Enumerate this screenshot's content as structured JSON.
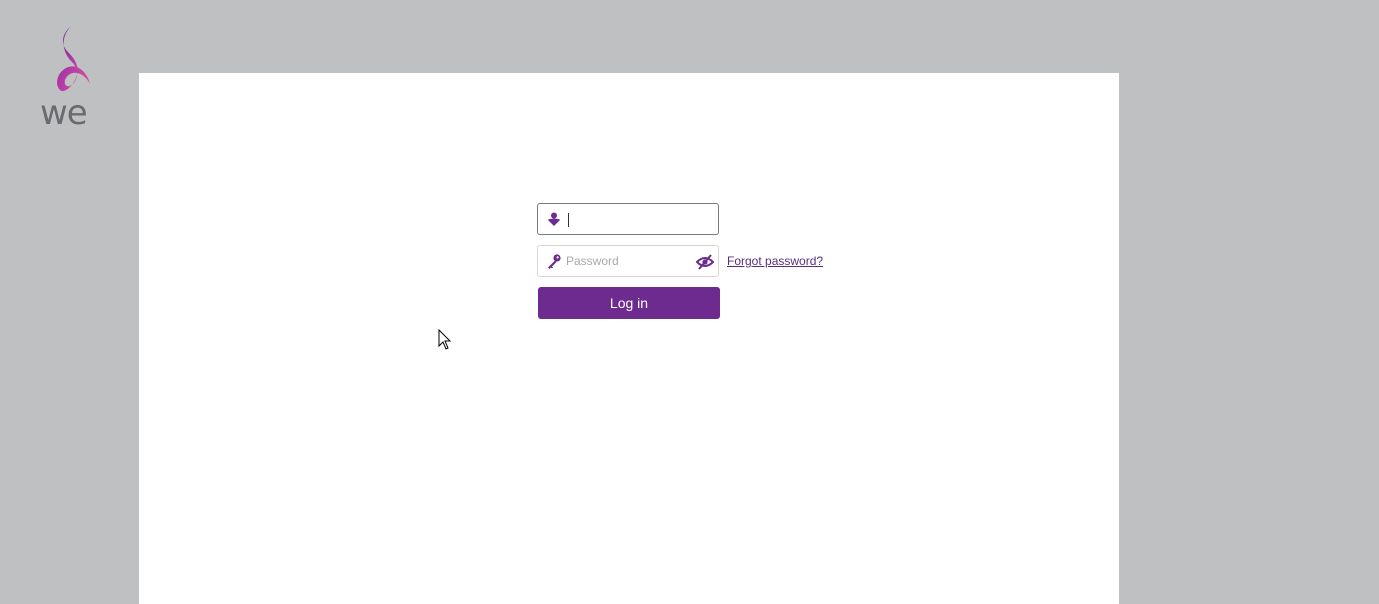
{
  "brand": {
    "logo_text": "we",
    "accent_color": "#6d2a8f"
  },
  "login_form": {
    "username": {
      "value": "",
      "placeholder": "",
      "icon": "user-icon"
    },
    "password": {
      "value": "",
      "placeholder": "Password",
      "icon": "key-icon",
      "toggle_icon": "eye-slash-icon"
    },
    "forgot_password_label": "Forgot password?",
    "login_button_label": "Log in"
  }
}
